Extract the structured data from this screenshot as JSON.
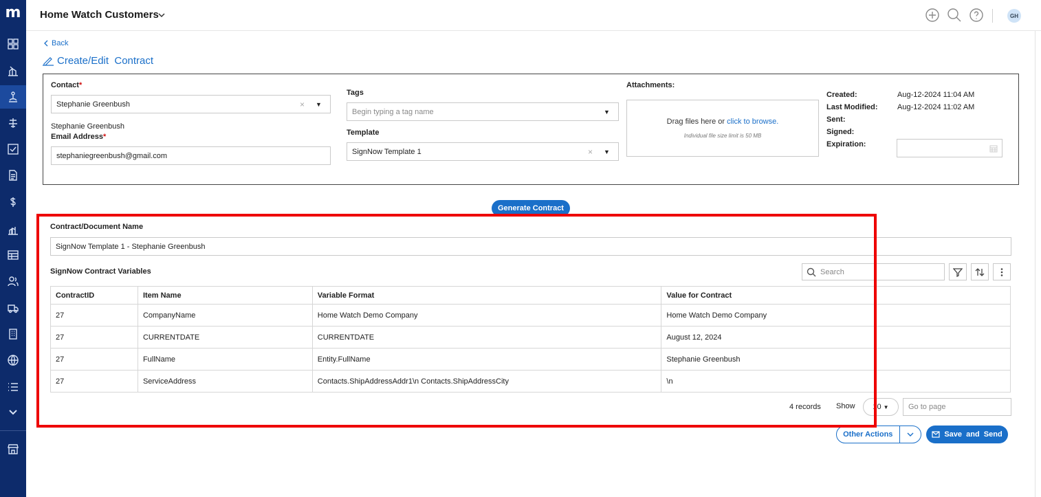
{
  "app": {
    "logo": "m",
    "title": "Home Watch Customers",
    "avatar": "GH"
  },
  "nav": {
    "back": "Back",
    "page_title": "Create/Edit  Contract"
  },
  "contact": {
    "label": "Contact",
    "value": "Stephanie Greenbush",
    "name_display": "Stephanie Greenbush",
    "email_label": "Email Address",
    "email_value": "stephaniegreenbush@gmail.com"
  },
  "tags": {
    "label": "Tags",
    "placeholder": "Begin typing a tag name"
  },
  "template": {
    "label": "Template",
    "value": "SignNow Template 1"
  },
  "attachments": {
    "label": "Attachments:",
    "drop_text": "Drag files here or",
    "browse_link": "click to browse.",
    "limit": "Individual file size limit is 50 MB"
  },
  "meta": {
    "created_label": "Created:",
    "created_value": "Aug-12-2024 11:04 AM",
    "modified_label": "Last Modified:",
    "modified_value": "Aug-12-2024 11:02 AM",
    "sent_label": "Sent:",
    "signed_label": "Signed:",
    "expiration_label": "Expiration:"
  },
  "generate_button": "Generate Contract",
  "document": {
    "label": "Contract/Document Name",
    "value": "SignNow Template 1 - Stephanie Greenbush"
  },
  "variables": {
    "label": "SignNow Contract Variables",
    "search_placeholder": "Search",
    "columns": [
      "ContractID",
      "Item Name",
      "Variable Format",
      "Value for Contract"
    ],
    "rows": [
      [
        "27",
        "CompanyName",
        "Home Watch Demo Company",
        "Home Watch Demo Company"
      ],
      [
        "27",
        "CURRENTDATE",
        "CURRENTDATE",
        "August 12, 2024"
      ],
      [
        "27",
        "FullName",
        "Entity.FullName",
        "Stephanie Greenbush"
      ],
      [
        "27",
        "ServiceAddress",
        "Contacts.ShipAddressAddr1\\n Contacts.ShipAddressCity",
        "\\n"
      ]
    ]
  },
  "pagination": {
    "records": "4 records",
    "show_label": "Show",
    "page_size": "10",
    "goto_placeholder": "Go to page"
  },
  "actions": {
    "other": "Other Actions",
    "save_send": "Save  and  Send"
  },
  "colors": {
    "sidebar": "#0d2b6b",
    "accent": "#1a6fc9",
    "highlight": "#ee0000"
  }
}
